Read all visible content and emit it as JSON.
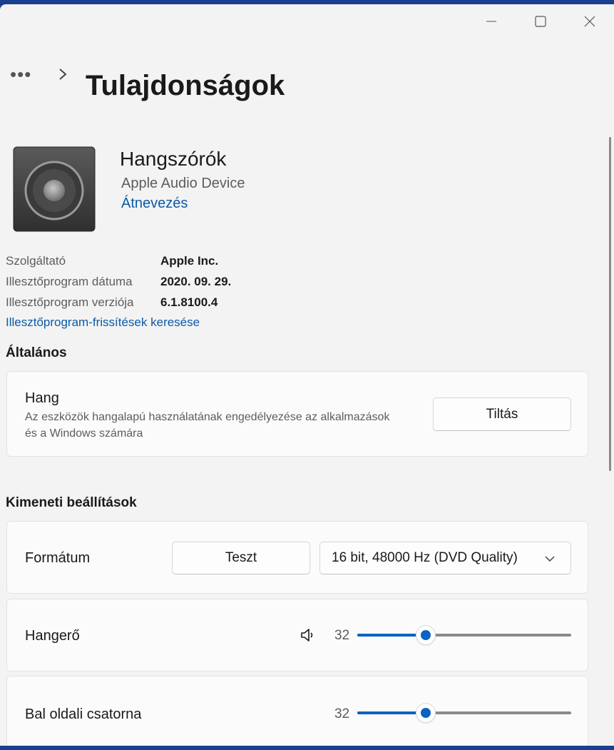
{
  "window": {
    "title_bar": {
      "minimize_icon": "minimize-icon",
      "maximize_icon": "maximize-icon",
      "close_icon": "close-icon"
    }
  },
  "breadcrumb": {
    "overflow": "•••",
    "title": "Tulajdonságok"
  },
  "device": {
    "icon": "speaker-icon",
    "name": "Hangszórók",
    "model": "Apple Audio Device",
    "rename_link": "Átnevezés"
  },
  "properties": [
    {
      "label": "Szolgáltató",
      "value": "Apple Inc."
    },
    {
      "label": "Illesztőprogram dátuma",
      "value": "2020. 09. 29."
    },
    {
      "label": "Illesztőprogram verziója",
      "value": "6.1.8100.4"
    }
  ],
  "driver_update_link": "Illesztőprogram-frissítések keresése",
  "general": {
    "title": "Általános",
    "audio": {
      "label": "Hang",
      "description": "Az eszközök hangalapú használatának engedélyezése az alkalmazások és a Windows számára",
      "button": "Tiltás"
    }
  },
  "output": {
    "title": "Kimeneti beállítások",
    "format": {
      "label": "Formátum",
      "test_button": "Teszt",
      "selected": "16 bit, 48000 Hz (DVD Quality)"
    },
    "volume": {
      "label": "Hangerő",
      "icon": "volume-icon",
      "value": "32",
      "level": 32
    },
    "left_channel": {
      "label": "Bal oldali csatorna",
      "value": "32",
      "level": 32
    }
  },
  "colors": {
    "accent": "#0a63c0",
    "link": "#0a5aa8"
  }
}
